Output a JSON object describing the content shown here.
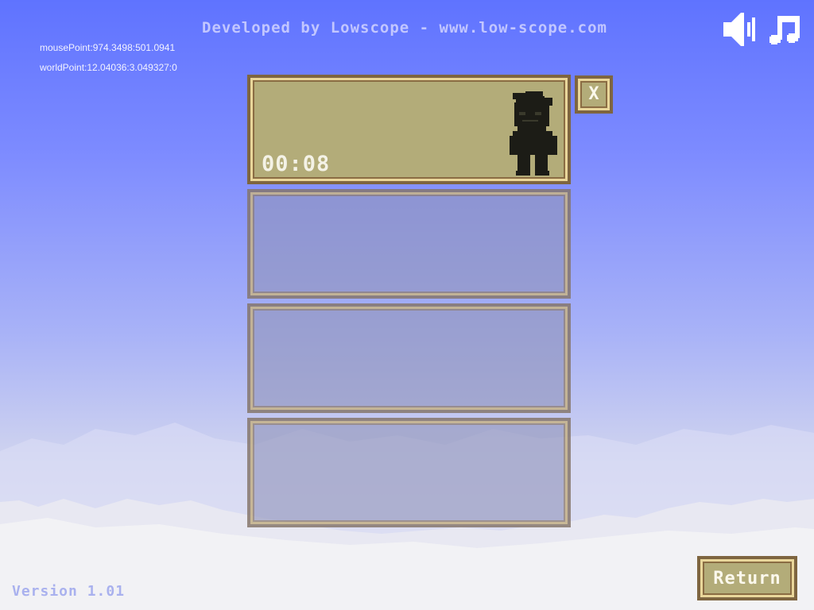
{
  "header": {
    "developer_credit": "Developed by Lowscope - www.low-scope.com"
  },
  "debug": {
    "mouse_point": "mousePoint:974.3498:501.0941",
    "world_point": "worldPoint:12.04036:3.049327:0"
  },
  "audio_controls": {
    "sound_icon": "speaker-icon",
    "music_icon": "music-note-icon"
  },
  "save_slots": [
    {
      "state": "filled",
      "play_time": "00:08",
      "character_icon": "character-silhouette-icon"
    },
    {
      "state": "empty"
    },
    {
      "state": "empty"
    },
    {
      "state": "empty"
    }
  ],
  "delete_button": {
    "icon": "close-icon",
    "glyph": "X"
  },
  "return_button": {
    "label": "Return"
  },
  "footer": {
    "version": "Version 1.01"
  },
  "colors": {
    "sky_top": "#5f73ff",
    "panel_fill": "#b3ac79",
    "panel_border": "#7e6540",
    "panel_highlight": "#e9d69a",
    "empty_slot_fill": "#9194b9",
    "text_light": "#f4f2e6"
  }
}
